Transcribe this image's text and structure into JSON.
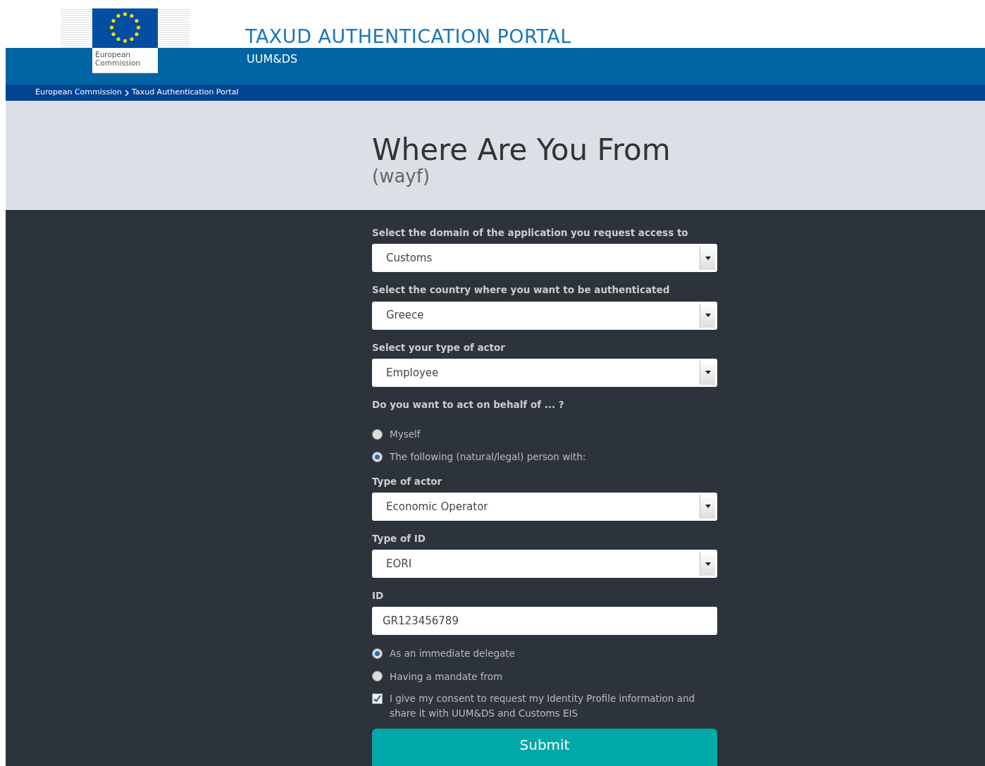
{
  "header": {
    "logo_text": "European Commission",
    "title": "TAXUD AUTHENTICATION PORTAL",
    "subtitle": "UUM&DS"
  },
  "breadcrumb": [
    {
      "label": "European Commission"
    },
    {
      "label": "Taxud Authentication Portal"
    }
  ],
  "page": {
    "title": "Where Are You From",
    "subtitle": "(wayf)"
  },
  "form": [
    {
      "kind": "select",
      "label": "Select the domain of the application you request access to",
      "value": "Customs"
    },
    {
      "kind": "select",
      "label": "Select the country where you want to be authenticated",
      "value": "Greece"
    },
    {
      "kind": "select",
      "label": "Select your type of actor",
      "value": "Employee"
    },
    {
      "kind": "radios",
      "label": "Do you want to act on behalf of ... ?",
      "options": [
        {
          "label": "Myself",
          "selected": false
        },
        {
          "label": "The following (natural/legal) person with:",
          "selected": true
        }
      ]
    },
    {
      "kind": "select",
      "label": "Type of actor",
      "value": "Economic Operator"
    },
    {
      "kind": "select",
      "label": "Type of ID",
      "value": "EORI"
    },
    {
      "kind": "text",
      "label": "ID",
      "value": "GR123456789"
    },
    {
      "kind": "radios",
      "options": [
        {
          "label": "As an immediate delegate",
          "selected": true
        },
        {
          "label": "Having a mandate from",
          "selected": false
        }
      ]
    },
    {
      "kind": "checkbox",
      "label": "I give my consent to request my Identity Profile information and share it with UUM&DS and Customs EIS",
      "checked": true
    }
  ],
  "submit": "Submit"
}
